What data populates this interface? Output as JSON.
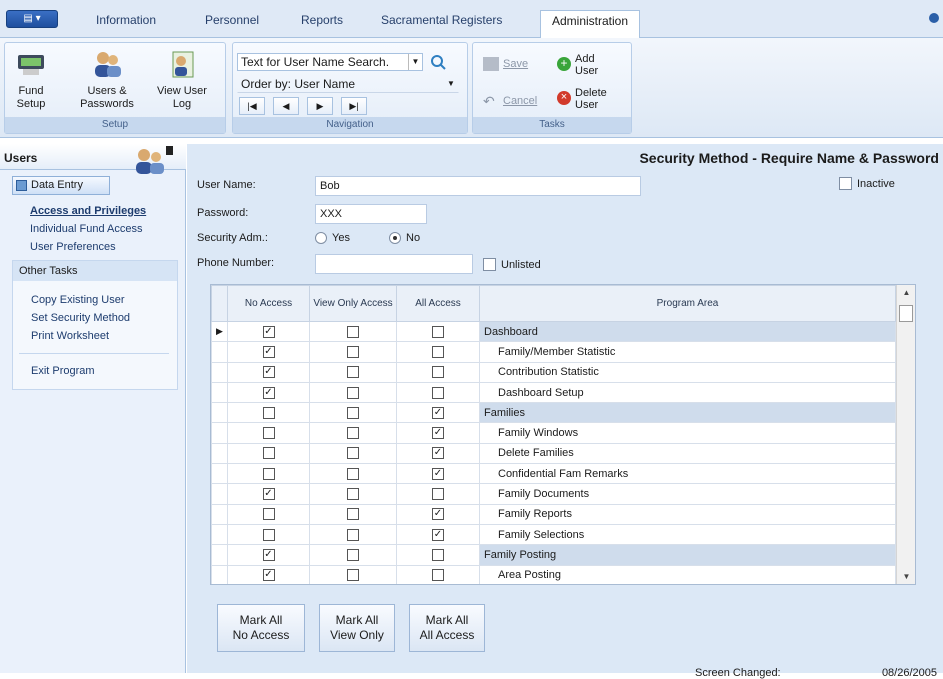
{
  "tabs": [
    "Information",
    "Personnel",
    "Reports",
    "Sacramental Registers",
    "Administration"
  ],
  "ribbon": {
    "setup": {
      "fund_setup": "Fund Setup",
      "users_passwords": "Users & Passwords",
      "view_user_log": "View User Log",
      "label": "Setup"
    },
    "navigation": {
      "search_text": "Text for User Name Search.",
      "order_by": "Order by:  User Name",
      "label": "Navigation"
    },
    "tasks": {
      "save": "Save",
      "add_user": "Add User",
      "cancel": "Cancel",
      "delete_user": "Delete User",
      "label": "Tasks"
    }
  },
  "sidebar": {
    "header": "Users",
    "tab": "Data Entry",
    "links": [
      "Access and Privileges",
      "Individual Fund Access",
      "User Preferences"
    ],
    "other_tasks_header": "Other Tasks",
    "other_tasks": [
      "Copy Existing User",
      "Set Security Method",
      "Print Worksheet"
    ],
    "exit": "Exit Program"
  },
  "main": {
    "title": "Security Method - Require Name & Password",
    "user_name_label": "User Name:",
    "user_name_value": "Bob",
    "inactive_label": "Inactive",
    "password_label": "Password:",
    "password_value": "XXX",
    "security_adm_label": "Security Adm.:",
    "yes_label": "Yes",
    "no_label": "No",
    "phone_label": "Phone Number:",
    "phone_value": "",
    "unlisted_label": "Unlisted",
    "columns": [
      "No Access",
      "View Only Access",
      "All Access",
      "Program Area"
    ],
    "rows": [
      {
        "area": "Dashboard",
        "group": true,
        "no": true,
        "view": false,
        "all": false,
        "current": true
      },
      {
        "area": "Family/Member Statistic",
        "group": false,
        "no": true,
        "view": false,
        "all": false
      },
      {
        "area": "Contribution Statistic",
        "group": false,
        "no": true,
        "view": false,
        "all": false
      },
      {
        "area": "Dashboard Setup",
        "group": false,
        "no": true,
        "view": false,
        "all": false
      },
      {
        "area": "Families",
        "group": true,
        "no": false,
        "view": false,
        "all": true
      },
      {
        "area": "Family Windows",
        "group": false,
        "no": false,
        "view": false,
        "all": true
      },
      {
        "area": "Delete Families",
        "group": false,
        "no": false,
        "view": false,
        "all": true
      },
      {
        "area": "Confidential Fam Remarks",
        "group": false,
        "no": false,
        "view": false,
        "all": true
      },
      {
        "area": "Family Documents",
        "group": false,
        "no": true,
        "view": false,
        "all": false
      },
      {
        "area": "Family Reports",
        "group": false,
        "no": false,
        "view": false,
        "all": true
      },
      {
        "area": "Family Selections",
        "group": false,
        "no": false,
        "view": false,
        "all": true
      },
      {
        "area": "Family Posting",
        "group": true,
        "no": true,
        "view": false,
        "all": false
      },
      {
        "area": "Area Posting",
        "group": false,
        "no": true,
        "view": false,
        "all": false
      }
    ],
    "mark_no": "Mark All\nNo Access",
    "mark_view": "Mark All\nView Only",
    "mark_all": "Mark All\nAll Access",
    "screen_changed_label": "Screen Changed:",
    "screen_changed_value": "08/26/2005"
  }
}
